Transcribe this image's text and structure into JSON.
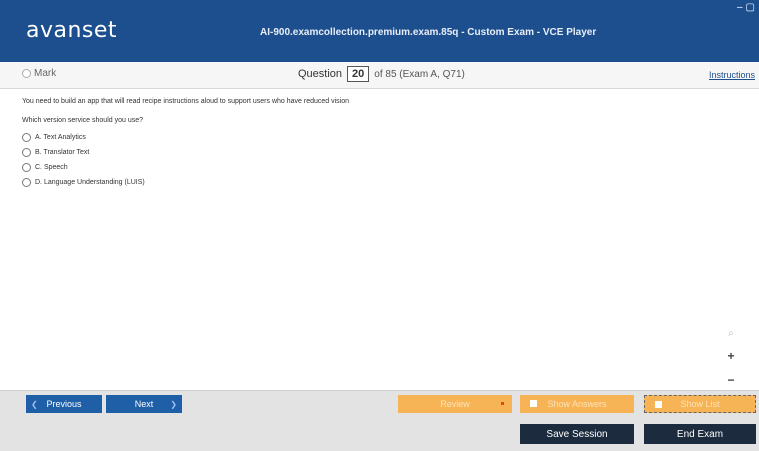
{
  "app": {
    "logo": "avanset",
    "window_title": "AI-900.examcollection.premium.exam.85q - Custom Exam - VCE Player",
    "controls": {
      "minimize": "–",
      "maximize": "▢"
    }
  },
  "question_bar": {
    "mark_label": "Mark",
    "question_label": "Question",
    "question_number": "20",
    "of_label": "of 85 (Exam A, Q71)",
    "instructions_label": "Instructions"
  },
  "question": {
    "text": "You need to build an app that will read recipe instructions aloud to support users who have reduced vision",
    "prompt": "Which version service should you use?",
    "options": [
      {
        "label": "A.  Text Analytics"
      },
      {
        "label": "B.  Translator Text"
      },
      {
        "label": "C.  Speech"
      },
      {
        "label": "D.  Language Understanding (LUIS)"
      }
    ]
  },
  "zoom": {
    "icon": "magnifier-icon",
    "plus": "+",
    "minus": "−"
  },
  "footer": {
    "previous_label": "Previous",
    "next_label": "Next",
    "review_label": "Review",
    "show_answers_label": "Show Answers",
    "show_list_label": "Show List",
    "save_session_label": "Save Session",
    "end_exam_label": "End Exam"
  },
  "colors": {
    "title_bar": "#1d4f8f",
    "nav_button": "#1f5fa8",
    "orange_button": "#f7b457",
    "dark_button": "#1c2b3d"
  }
}
